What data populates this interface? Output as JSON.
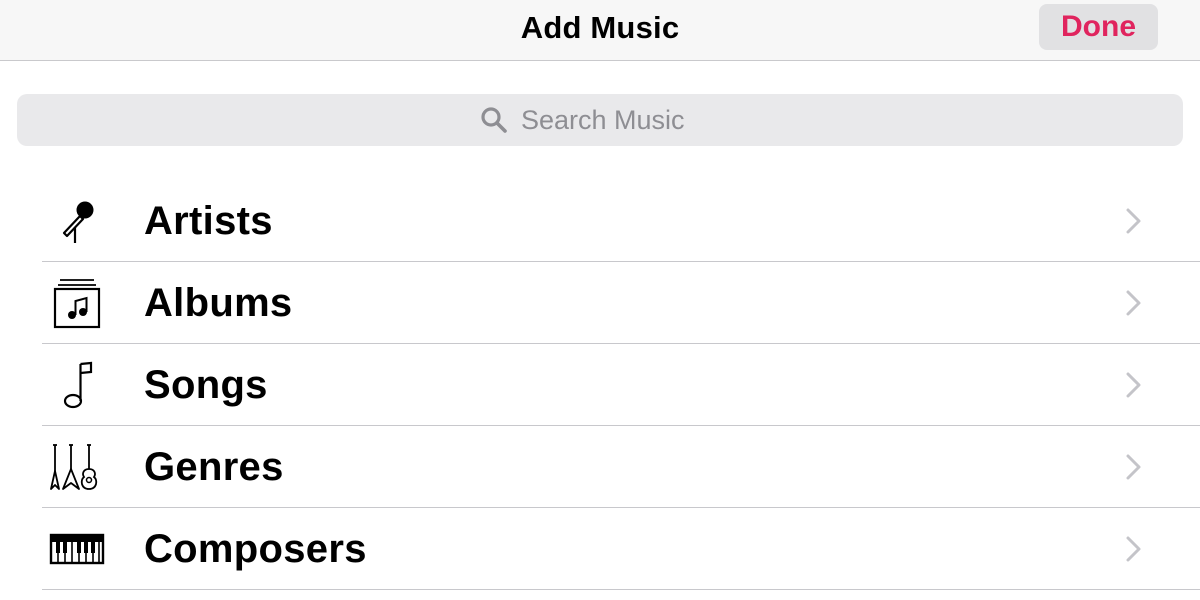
{
  "navbar": {
    "title": "Add Music",
    "done_label": "Done",
    "accent_color": "#e0245e"
  },
  "search": {
    "placeholder": "Search Music",
    "value": "",
    "icon": "search-icon"
  },
  "categories": [
    {
      "label": "Artists",
      "icon": "microphone-icon"
    },
    {
      "label": "Albums",
      "icon": "album-icon"
    },
    {
      "label": "Songs",
      "icon": "music-note-icon"
    },
    {
      "label": "Genres",
      "icon": "guitars-icon"
    },
    {
      "label": "Composers",
      "icon": "piano-keyboard-icon"
    }
  ]
}
